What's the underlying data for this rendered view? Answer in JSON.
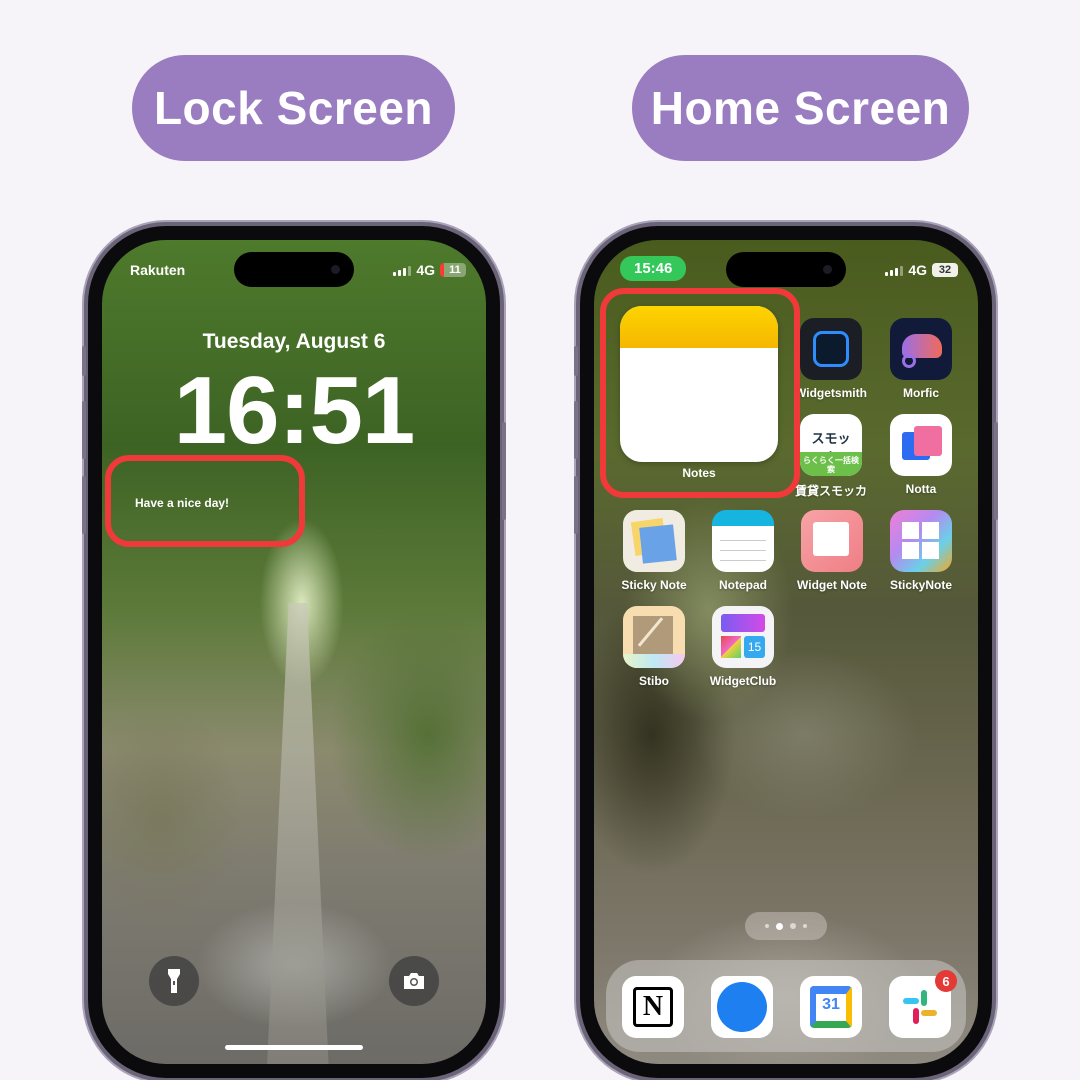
{
  "titles": {
    "lock": "Lock Screen",
    "home": "Home Screen"
  },
  "colors": {
    "title_pill": "#9a7cc0",
    "highlight": "#f03a3a",
    "time_pill": "#34c759",
    "background": "#f6f4f8"
  },
  "lock_screen": {
    "carrier": "Rakuten",
    "network": "4G",
    "battery": "11",
    "date": "Tuesday, August 6",
    "time": "16:51",
    "widget_text": "Have a nice day!",
    "buttons": {
      "flashlight": "flashlight-icon",
      "camera": "camera-icon"
    }
  },
  "home_screen": {
    "time": "15:46",
    "network": "4G",
    "battery": "32",
    "notes_widget_label": "Notes",
    "apps": [
      {
        "label": "Widgetsmith"
      },
      {
        "label": "Morfic"
      },
      {
        "label": "賃貸スモッカ",
        "icon_text": "スモッカ",
        "icon_subtext": "らくらく一括検索"
      },
      {
        "label": "Notta"
      },
      {
        "label": "Sticky Note"
      },
      {
        "label": "Notepad"
      },
      {
        "label": "Widget Note"
      },
      {
        "label": "StickyNote"
      },
      {
        "label": "Stibo"
      },
      {
        "label": "WidgetClub",
        "icon_text": "15"
      }
    ],
    "dock": [
      {
        "name": "Notion",
        "icon_text": "N"
      },
      {
        "name": "Safari"
      },
      {
        "name": "Google Calendar",
        "icon_text": "31"
      },
      {
        "name": "Slack",
        "badge": "6"
      }
    ],
    "page_indicator": {
      "pages": 4,
      "current": 2
    }
  }
}
